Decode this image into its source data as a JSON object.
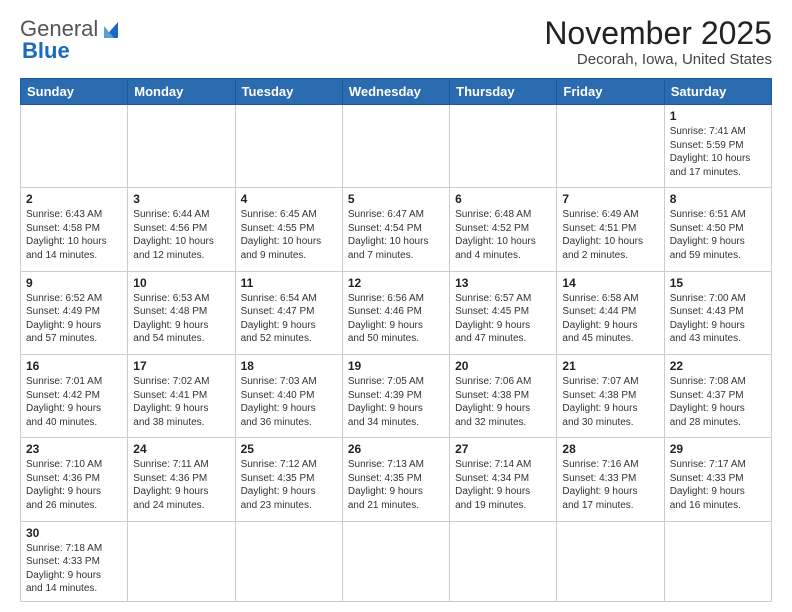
{
  "header": {
    "logo_general": "General",
    "logo_blue": "Blue",
    "month_title": "November 2025",
    "location": "Decorah, Iowa, United States"
  },
  "weekdays": [
    "Sunday",
    "Monday",
    "Tuesday",
    "Wednesday",
    "Thursday",
    "Friday",
    "Saturday"
  ],
  "weeks": [
    [
      {
        "day": "",
        "info": ""
      },
      {
        "day": "",
        "info": ""
      },
      {
        "day": "",
        "info": ""
      },
      {
        "day": "",
        "info": ""
      },
      {
        "day": "",
        "info": ""
      },
      {
        "day": "",
        "info": ""
      },
      {
        "day": "1",
        "info": "Sunrise: 7:41 AM\nSunset: 5:59 PM\nDaylight: 10 hours\nand 17 minutes."
      }
    ],
    [
      {
        "day": "2",
        "info": "Sunrise: 6:43 AM\nSunset: 4:58 PM\nDaylight: 10 hours\nand 14 minutes."
      },
      {
        "day": "3",
        "info": "Sunrise: 6:44 AM\nSunset: 4:56 PM\nDaylight: 10 hours\nand 12 minutes."
      },
      {
        "day": "4",
        "info": "Sunrise: 6:45 AM\nSunset: 4:55 PM\nDaylight: 10 hours\nand 9 minutes."
      },
      {
        "day": "5",
        "info": "Sunrise: 6:47 AM\nSunset: 4:54 PM\nDaylight: 10 hours\nand 7 minutes."
      },
      {
        "day": "6",
        "info": "Sunrise: 6:48 AM\nSunset: 4:52 PM\nDaylight: 10 hours\nand 4 minutes."
      },
      {
        "day": "7",
        "info": "Sunrise: 6:49 AM\nSunset: 4:51 PM\nDaylight: 10 hours\nand 2 minutes."
      },
      {
        "day": "8",
        "info": "Sunrise: 6:51 AM\nSunset: 4:50 PM\nDaylight: 9 hours\nand 59 minutes."
      }
    ],
    [
      {
        "day": "9",
        "info": "Sunrise: 6:52 AM\nSunset: 4:49 PM\nDaylight: 9 hours\nand 57 minutes."
      },
      {
        "day": "10",
        "info": "Sunrise: 6:53 AM\nSunset: 4:48 PM\nDaylight: 9 hours\nand 54 minutes."
      },
      {
        "day": "11",
        "info": "Sunrise: 6:54 AM\nSunset: 4:47 PM\nDaylight: 9 hours\nand 52 minutes."
      },
      {
        "day": "12",
        "info": "Sunrise: 6:56 AM\nSunset: 4:46 PM\nDaylight: 9 hours\nand 50 minutes."
      },
      {
        "day": "13",
        "info": "Sunrise: 6:57 AM\nSunset: 4:45 PM\nDaylight: 9 hours\nand 47 minutes."
      },
      {
        "day": "14",
        "info": "Sunrise: 6:58 AM\nSunset: 4:44 PM\nDaylight: 9 hours\nand 45 minutes."
      },
      {
        "day": "15",
        "info": "Sunrise: 7:00 AM\nSunset: 4:43 PM\nDaylight: 9 hours\nand 43 minutes."
      }
    ],
    [
      {
        "day": "16",
        "info": "Sunrise: 7:01 AM\nSunset: 4:42 PM\nDaylight: 9 hours\nand 40 minutes."
      },
      {
        "day": "17",
        "info": "Sunrise: 7:02 AM\nSunset: 4:41 PM\nDaylight: 9 hours\nand 38 minutes."
      },
      {
        "day": "18",
        "info": "Sunrise: 7:03 AM\nSunset: 4:40 PM\nDaylight: 9 hours\nand 36 minutes."
      },
      {
        "day": "19",
        "info": "Sunrise: 7:05 AM\nSunset: 4:39 PM\nDaylight: 9 hours\nand 34 minutes."
      },
      {
        "day": "20",
        "info": "Sunrise: 7:06 AM\nSunset: 4:38 PM\nDaylight: 9 hours\nand 32 minutes."
      },
      {
        "day": "21",
        "info": "Sunrise: 7:07 AM\nSunset: 4:38 PM\nDaylight: 9 hours\nand 30 minutes."
      },
      {
        "day": "22",
        "info": "Sunrise: 7:08 AM\nSunset: 4:37 PM\nDaylight: 9 hours\nand 28 minutes."
      }
    ],
    [
      {
        "day": "23",
        "info": "Sunrise: 7:10 AM\nSunset: 4:36 PM\nDaylight: 9 hours\nand 26 minutes."
      },
      {
        "day": "24",
        "info": "Sunrise: 7:11 AM\nSunset: 4:36 PM\nDaylight: 9 hours\nand 24 minutes."
      },
      {
        "day": "25",
        "info": "Sunrise: 7:12 AM\nSunset: 4:35 PM\nDaylight: 9 hours\nand 23 minutes."
      },
      {
        "day": "26",
        "info": "Sunrise: 7:13 AM\nSunset: 4:35 PM\nDaylight: 9 hours\nand 21 minutes."
      },
      {
        "day": "27",
        "info": "Sunrise: 7:14 AM\nSunset: 4:34 PM\nDaylight: 9 hours\nand 19 minutes."
      },
      {
        "day": "28",
        "info": "Sunrise: 7:16 AM\nSunset: 4:33 PM\nDaylight: 9 hours\nand 17 minutes."
      },
      {
        "day": "29",
        "info": "Sunrise: 7:17 AM\nSunset: 4:33 PM\nDaylight: 9 hours\nand 16 minutes."
      }
    ],
    [
      {
        "day": "30",
        "info": "Sunrise: 7:18 AM\nSunset: 4:33 PM\nDaylight: 9 hours\nand 14 minutes."
      },
      {
        "day": "",
        "info": ""
      },
      {
        "day": "",
        "info": ""
      },
      {
        "day": "",
        "info": ""
      },
      {
        "day": "",
        "info": ""
      },
      {
        "day": "",
        "info": ""
      },
      {
        "day": "",
        "info": ""
      }
    ]
  ]
}
